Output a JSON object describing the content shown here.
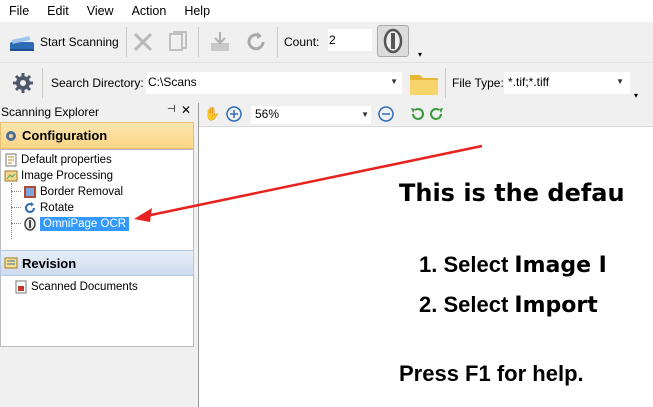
{
  "menu": [
    "File",
    "Edit",
    "View",
    "Action",
    "Help"
  ],
  "toolbar": {
    "start_label": "Start Scanning",
    "count_label": "Count:",
    "count_value": "2"
  },
  "toolbar2": {
    "search_dir_label": "Search Directory:",
    "search_dir_value": "C:\\Scans",
    "file_type_label": "File Type:",
    "file_type_value": "*.tif;*.tiff"
  },
  "explorer": {
    "title": "Scanning Explorer",
    "configuration": "Configuration",
    "tree": [
      "Default properties",
      "Image Processing",
      "Border Removal",
      "Rotate",
      "OmniPage OCR"
    ],
    "revision": "Revision",
    "revision_item": "Scanned Documents"
  },
  "viewer": {
    "zoom": "56%",
    "line1": "This is the defau",
    "line2_num": "1. Select ",
    "line2_bold": "Image I",
    "line3_num": "2. Select ",
    "line3_bold": "Import",
    "line4": "Press F1 for help."
  },
  "colors": {
    "arrow": "#e8231f",
    "selection": "#3399ff"
  }
}
